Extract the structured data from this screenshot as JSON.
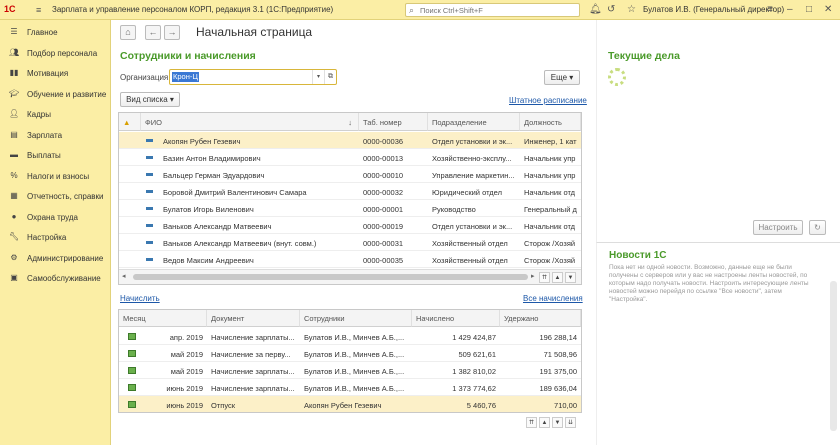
{
  "titlebar": {
    "logo": "1С",
    "app_title": "Зарплата и управление персоналом КОРП, редакция 3.1  (1С:Предприятие)",
    "search_placeholder": "Поиск Ctrl+Shift+F",
    "user": "Булатов И.В. (Генеральный директор)"
  },
  "sidebar": {
    "items": [
      {
        "label": "Главное",
        "icon": "menu-icon"
      },
      {
        "label": "Подбор персонала",
        "icon": "people-search-icon"
      },
      {
        "label": "Мотивация",
        "icon": "motivation-icon"
      },
      {
        "label": "Обучение и развитие",
        "icon": "graduation-icon"
      },
      {
        "label": "Кадры",
        "icon": "people-icon"
      },
      {
        "label": "Зарплата",
        "icon": "salary-icon"
      },
      {
        "label": "Выплаты",
        "icon": "payments-icon"
      },
      {
        "label": "Налоги и взносы",
        "icon": "percent-icon"
      },
      {
        "label": "Отчетность, справки",
        "icon": "report-icon"
      },
      {
        "label": "Охрана труда",
        "icon": "helmet-icon"
      },
      {
        "label": "Настройка",
        "icon": "wrench-icon"
      },
      {
        "label": "Администрирование",
        "icon": "gear-icon"
      },
      {
        "label": "Самообслуживание",
        "icon": "self-service-icon"
      }
    ]
  },
  "page": {
    "title": "Начальная страница",
    "employees_section_title": "Сотрудники и начисления",
    "org_label": "Организация:",
    "org_value": "Крон-Ц",
    "more_button": "Еще",
    "list_view_button": "Вид списка",
    "staff_schedule_link": "Штатное расписание",
    "accrue_link": "Начислить",
    "all_accruals_link": "Все начисления"
  },
  "employees": {
    "columns": [
      "ФИО",
      "Таб. номер",
      "Подразделение",
      "Должность"
    ],
    "rows": [
      {
        "name": "Акопян Рубен Гезевич",
        "tab": "0000-00036",
        "dept": "Отдел установки и эк...",
        "pos": "Инженер, 1 кат"
      },
      {
        "name": "Базин Антон Владимирович",
        "tab": "0000-00013",
        "dept": "Хозяйственно-эксплу...",
        "pos": "Начальник упр"
      },
      {
        "name": "Бальцер Герман Эдуардович",
        "tab": "0000-00010",
        "dept": "Управление маркетин...",
        "pos": "Начальник упр"
      },
      {
        "name": "Боровой Дмитрий Валентинович Самара",
        "tab": "0000-00032",
        "dept": "Юридический отдел",
        "pos": "Начальник отд"
      },
      {
        "name": "Булатов Игорь Виленович",
        "tab": "0000-00001",
        "dept": "Руководство",
        "pos": "Генеральный д"
      },
      {
        "name": "Ваньков Александр Матвеевич",
        "tab": "0000-00019",
        "dept": "Отдел установки и эк...",
        "pos": "Начальник отд"
      },
      {
        "name": "Ваньков Александр Матвеевич (внут. совм.)",
        "tab": "0000-00031",
        "dept": "Хозяйственный отдел",
        "pos": "Сторож /Хозяй"
      },
      {
        "name": "Ведов Максим Андреевич",
        "tab": "0000-00035",
        "dept": "Хозяйственный отдел",
        "pos": "Сторож /Хозяй"
      }
    ]
  },
  "payments": {
    "columns": [
      "Месяц",
      "Документ",
      "Сотрудники",
      "Начислено",
      "Удержано"
    ],
    "rows": [
      {
        "month": "апр. 2019",
        "doc": "Начисление зарплаты...",
        "emp": "Булатов И.В., Минчев А.Б.,...",
        "accrued": "1 429 424,87",
        "withheld": "196 288,14"
      },
      {
        "month": "май 2019",
        "doc": "Начисление за перву...",
        "emp": "Булатов И.В., Минчев А.Б.,...",
        "accrued": "509 621,61",
        "withheld": "71 508,96"
      },
      {
        "month": "май 2019",
        "doc": "Начисление зарплаты...",
        "emp": "Булатов И.В., Минчев А.Б.,...",
        "accrued": "1 382 810,02",
        "withheld": "191 375,00"
      },
      {
        "month": "июнь 2019",
        "doc": "Начисление зарплаты...",
        "emp": "Булатов И.В., Минчев А.Б.,...",
        "accrued": "1 373 774,62",
        "withheld": "189 636,04"
      },
      {
        "month": "июнь 2019",
        "doc": "Отпуск",
        "emp": "Акопян Рубен Гезевич",
        "accrued": "5 460,76",
        "withheld": "710,00"
      }
    ]
  },
  "current_tasks": {
    "title": "Текущие дела",
    "configure_button": "Настроить"
  },
  "news": {
    "title": "Новости 1С",
    "text": "Пока нет ни одной новости. Возможно, данные еще не были получены с серверов или у вас не настроены ленты новостей, по которым надо получать новости. Настроить интересующие ленты новостей можно перейдя по ссылке \"Все новости\", затем \"Настройка\"."
  },
  "colors": {
    "accent": "#fbeea5",
    "section_title": "#4a9a2a",
    "link": "#1c57a8",
    "selection": "#fcf0c8"
  }
}
